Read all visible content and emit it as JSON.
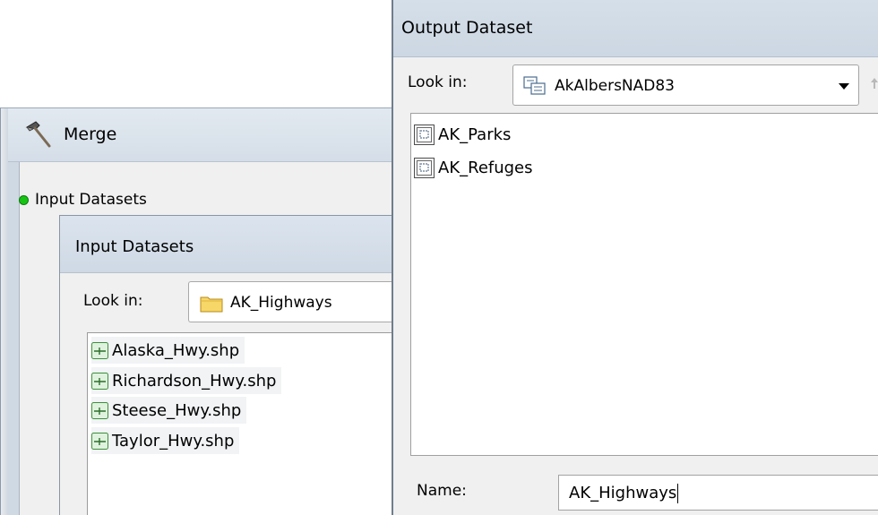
{
  "merge_window": {
    "title": "Merge",
    "parameter_label": "Input Datasets"
  },
  "input_dialog": {
    "title": "Input Datasets",
    "look_in_label": "Look in:",
    "look_in_value": "AK_Highways",
    "files": [
      {
        "name": "Alaska_Hwy.shp",
        "icon": "line-shapefile-icon"
      },
      {
        "name": "Richardson_Hwy.shp",
        "icon": "line-shapefile-icon"
      },
      {
        "name": "Steese_Hwy.shp",
        "icon": "line-shapefile-icon"
      },
      {
        "name": "Taylor_Hwy.shp",
        "icon": "line-shapefile-icon"
      }
    ]
  },
  "output_dialog": {
    "title": "Output Dataset",
    "look_in_label": "Look in:",
    "look_in_value": "AkAlbersNAD83",
    "items": [
      {
        "name": "AK_Parks",
        "icon": "feature-class-icon"
      },
      {
        "name": "AK_Refuges",
        "icon": "feature-class-icon"
      }
    ],
    "name_label": "Name:",
    "name_value": "AK_Highways"
  },
  "colors": {
    "status_dot": "#17c414",
    "titlebar": "#d5dfe9",
    "dialog_bg": "#f0f0f0"
  }
}
